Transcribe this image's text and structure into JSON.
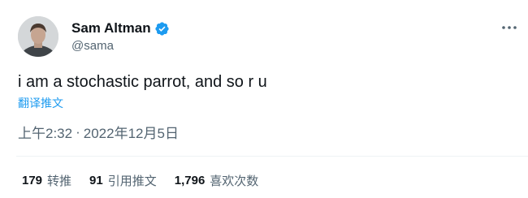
{
  "author": {
    "display_name": "Sam Altman",
    "handle": "@sama",
    "verified": true
  },
  "tweet": {
    "text": "i am a stochastic parrot, and so r u",
    "translate_label": "翻译推文",
    "time": "上午2:32",
    "separator": "·",
    "date": "2022年12月5日"
  },
  "stats": [
    {
      "count": "179",
      "label": "转推"
    },
    {
      "count": "91",
      "label": "引用推文"
    },
    {
      "count": "1,796",
      "label": "喜欢次数"
    }
  ],
  "icons": {
    "verified": "verified-badge-icon",
    "more": "more-horizontal-icon"
  },
  "colors": {
    "text_primary": "#0f1419",
    "text_secondary": "#536471",
    "accent": "#1d9bf0",
    "divider": "#eff3f4"
  }
}
